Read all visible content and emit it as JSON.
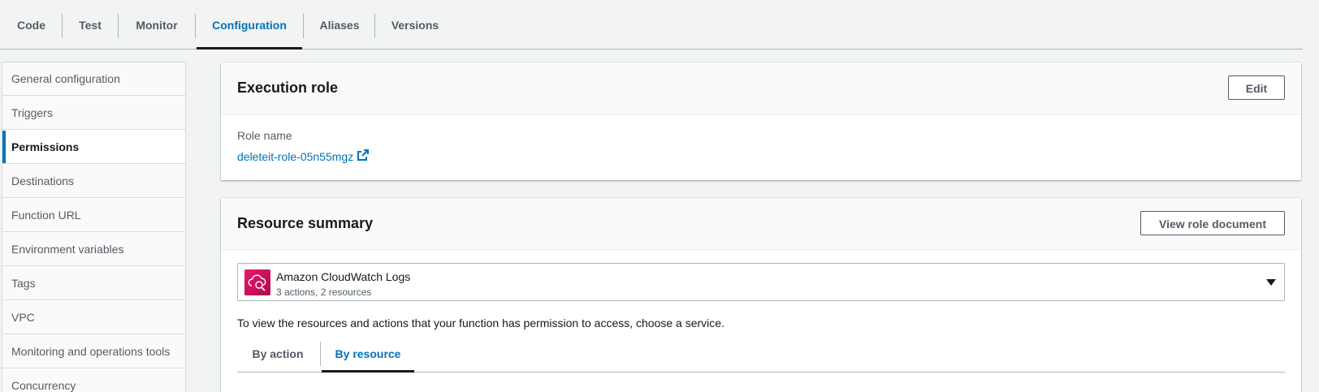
{
  "tabs": [
    {
      "label": "Code"
    },
    {
      "label": "Test"
    },
    {
      "label": "Monitor"
    },
    {
      "label": "Configuration",
      "active": true
    },
    {
      "label": "Aliases"
    },
    {
      "label": "Versions"
    }
  ],
  "sidebar": {
    "items": [
      {
        "label": "General configuration"
      },
      {
        "label": "Triggers"
      },
      {
        "label": "Permissions",
        "active": true
      },
      {
        "label": "Destinations"
      },
      {
        "label": "Function URL"
      },
      {
        "label": "Environment variables"
      },
      {
        "label": "Tags"
      },
      {
        "label": "VPC"
      },
      {
        "label": "Monitoring and operations tools"
      },
      {
        "label": "Concurrency"
      }
    ]
  },
  "execution_role": {
    "title": "Execution role",
    "edit_label": "Edit",
    "role_name_label": "Role name",
    "role_name": "deleteit-role-05n55mgz",
    "link_icon": "external-link-icon"
  },
  "resource_summary": {
    "title": "Resource summary",
    "view_doc_label": "View role document",
    "service": {
      "name": "Amazon CloudWatch Logs",
      "details": "3 actions, 2 resources",
      "icon": "cloudwatch-logs-icon"
    },
    "help_text": "To view the resources and actions that your function has permission to access, choose a service.",
    "sub_tabs": [
      {
        "label": "By action"
      },
      {
        "label": "By resource",
        "active": true
      }
    ]
  },
  "colors": {
    "accent": "#0073bb",
    "background": "#f2f3f3",
    "service_icon": "#d6246e"
  }
}
